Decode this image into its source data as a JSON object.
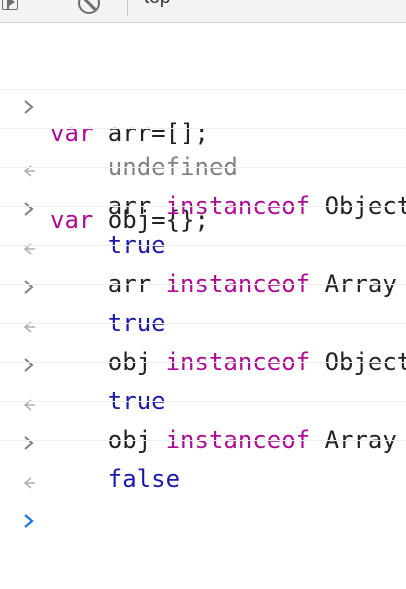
{
  "toolbar": {
    "context_label": "top",
    "icons": [
      "sidebar-panel-icon",
      "clear-console-icon",
      "dropdown-arrow-icon"
    ]
  },
  "colors": {
    "keyword": "#aa0d91",
    "code": "#222222",
    "undefined": "#808080",
    "boolean": "#1a1aa6",
    "prompt_active": "#1a73e8",
    "prompt_inactive": "#808080"
  },
  "console": {
    "entry1": {
      "line1": {
        "kw": "var",
        "rest": " arr=[];"
      },
      "line2": {
        "kw": "var",
        "rest": " obj={};"
      },
      "result": "undefined"
    },
    "entry2": {
      "left": "arr",
      "kw": "instanceof",
      "right": "Object",
      "result": "true"
    },
    "entry3": {
      "left": "arr",
      "kw": "instanceof",
      "right": "Array",
      "result": "true"
    },
    "entry4": {
      "left": "obj",
      "kw": "instanceof",
      "right": "Object",
      "result": "true"
    },
    "entry5": {
      "left": "obj",
      "kw": "instanceof",
      "right": "Array",
      "result": "false"
    }
  }
}
